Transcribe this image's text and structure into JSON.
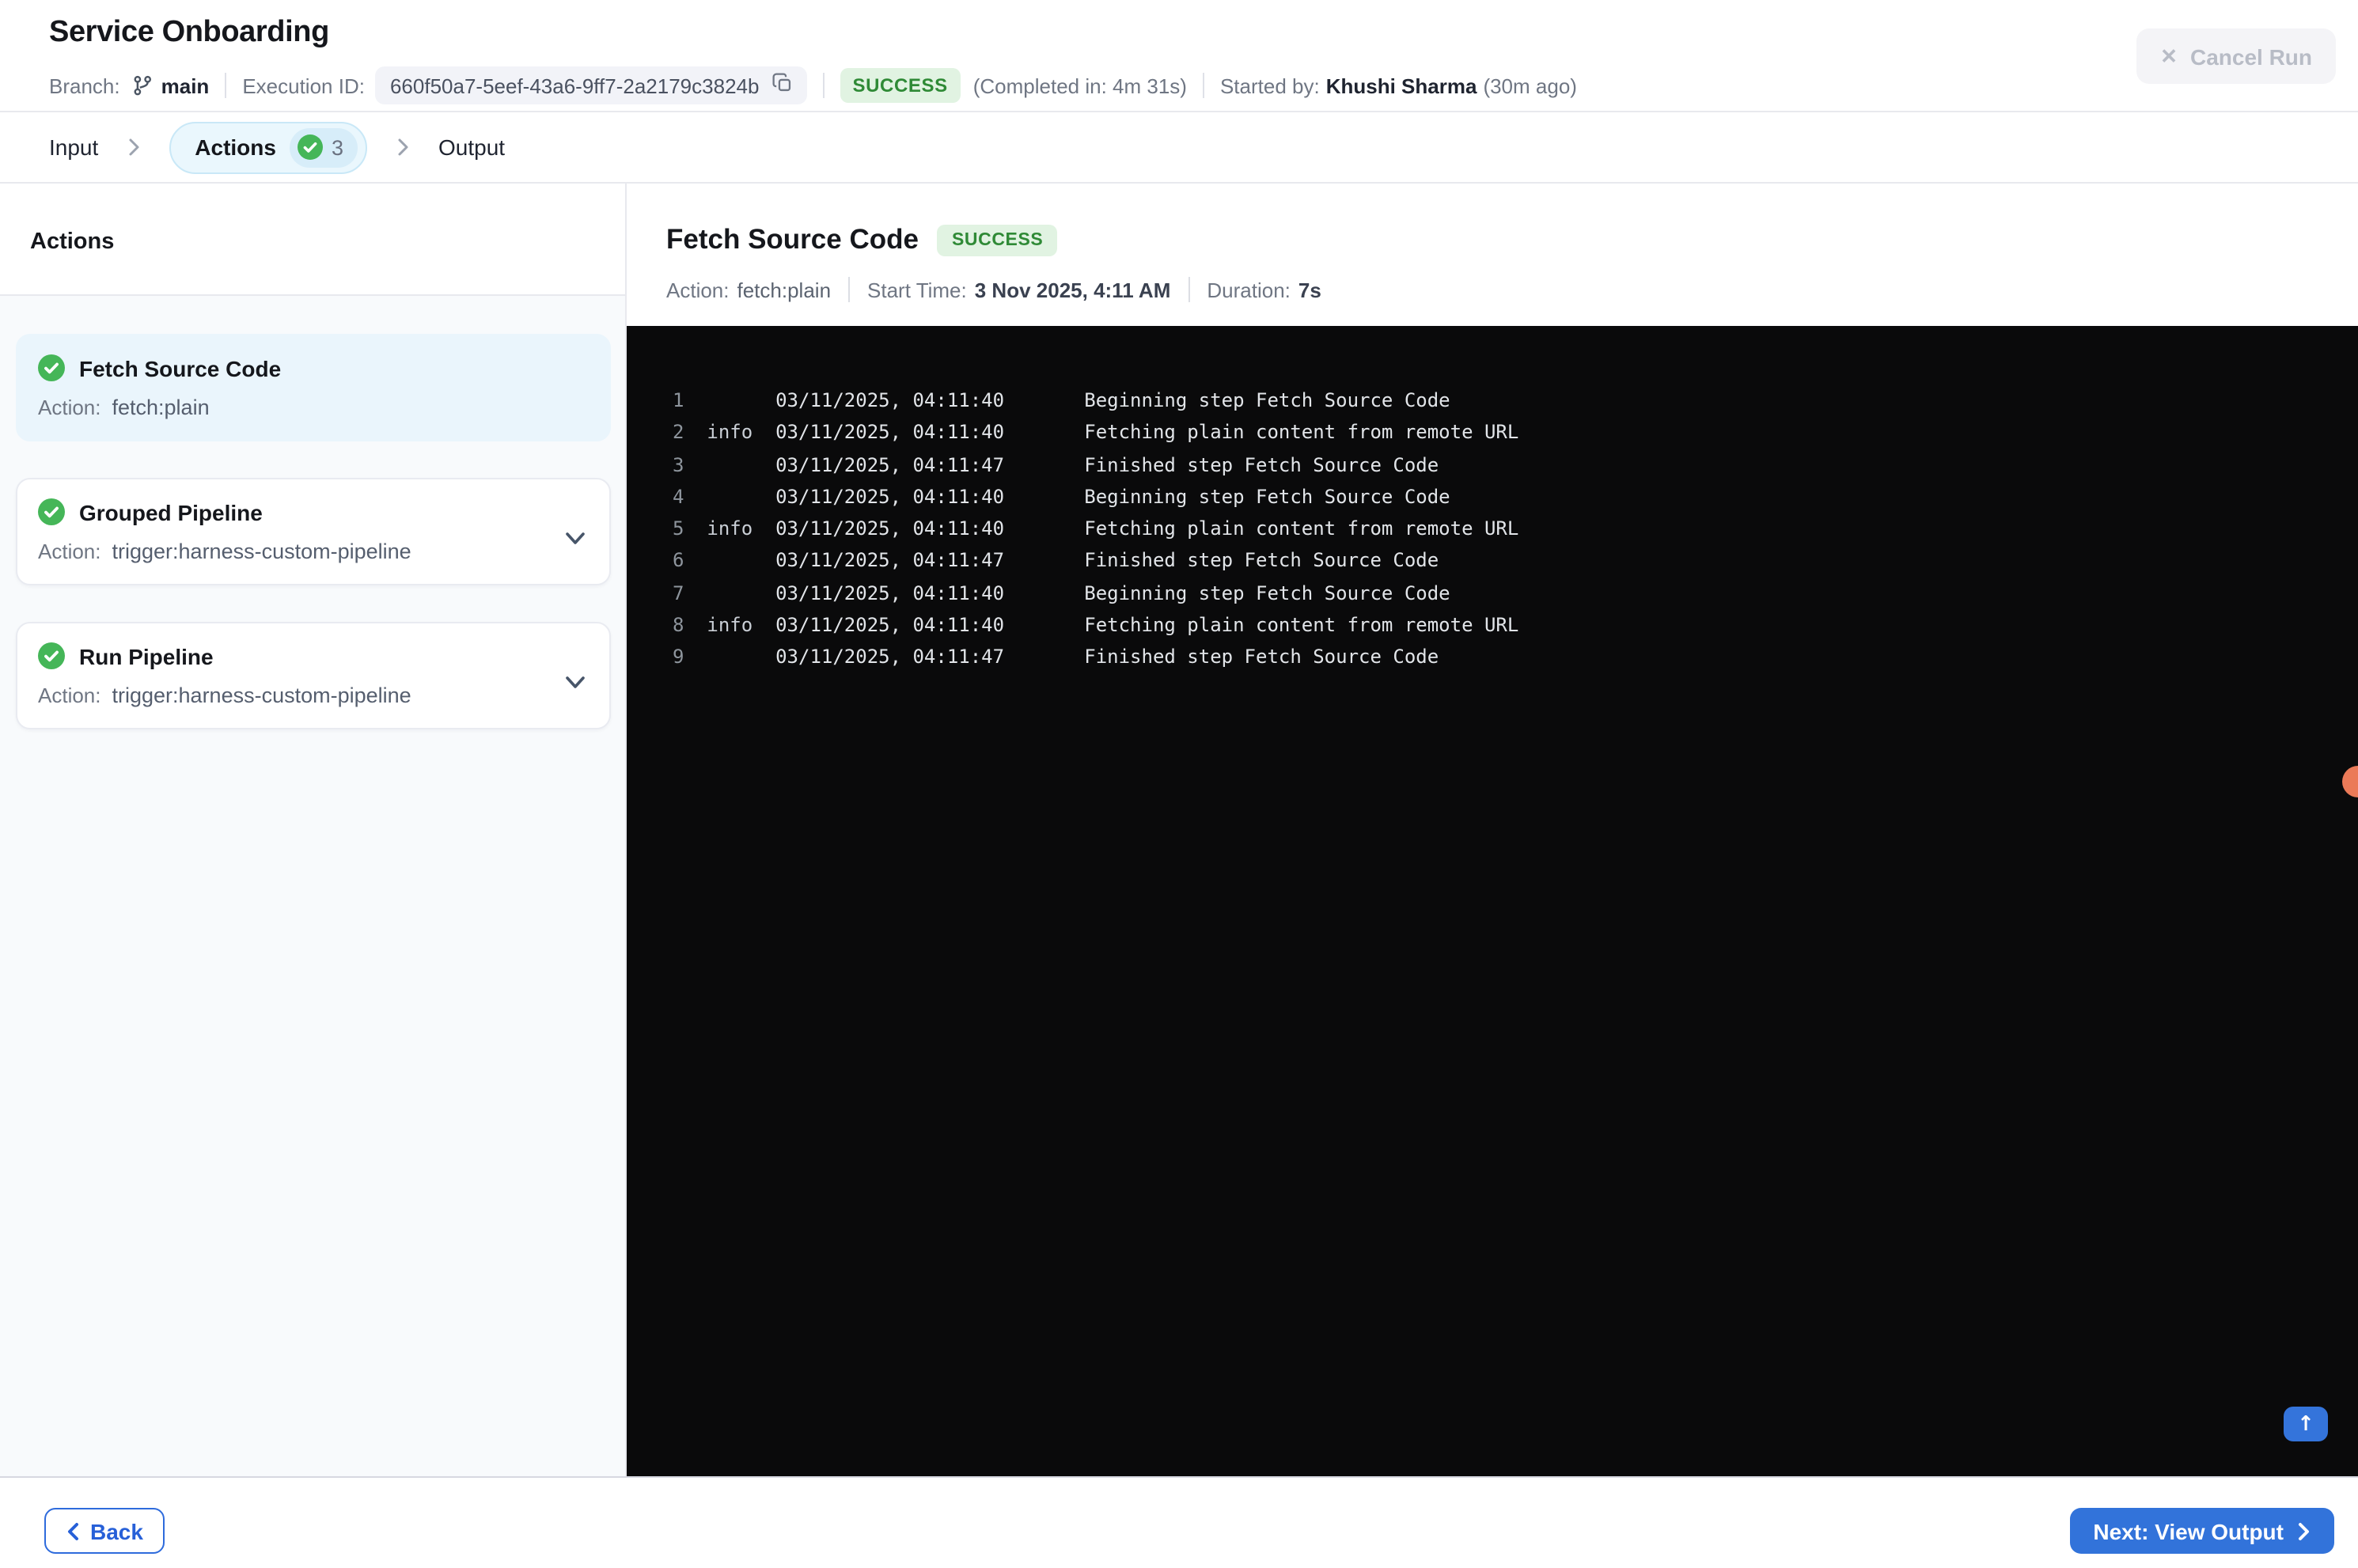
{
  "header": {
    "title": "Service Onboarding",
    "branch_label": "Branch:",
    "branch_name": "main",
    "execution_id_label": "Execution ID:",
    "execution_id": "660f50a7-5eef-43a6-9ff7-2a2179c3824b",
    "status": "SUCCESS",
    "completed_in": "(Completed in: 4m 31s)",
    "started_by_label": "Started by:",
    "started_by": "Khushi Sharma",
    "started_ago": "(30m ago)",
    "cancel_label": "Cancel Run"
  },
  "stepper": {
    "steps": [
      {
        "label": "Input"
      },
      {
        "label": "Actions",
        "count": "3"
      },
      {
        "label": "Output"
      }
    ]
  },
  "sidebar": {
    "heading": "Actions",
    "items": [
      {
        "title": "Fetch Source Code",
        "action_label": "Action:",
        "action": "fetch:plain"
      },
      {
        "title": "Grouped Pipeline",
        "action_label": "Action:",
        "action": "trigger:harness-custom-pipeline"
      },
      {
        "title": "Run Pipeline",
        "action_label": "Action:",
        "action": "trigger:harness-custom-pipeline"
      }
    ]
  },
  "detail": {
    "title": "Fetch Source Code",
    "status": "SUCCESS",
    "action_label": "Action:",
    "action_value": "fetch:plain",
    "start_label": "Start Time:",
    "start_value": "3 Nov 2025, 4:11 AM",
    "duration_label": "Duration:",
    "duration_value": "7s"
  },
  "log": {
    "lines": [
      {
        "n": "1",
        "level": "",
        "time": "03/11/2025, 04:11:40",
        "msg": "Beginning step Fetch Source Code"
      },
      {
        "n": "2",
        "level": "info",
        "time": "03/11/2025, 04:11:40",
        "msg": "Fetching plain content from remote URL"
      },
      {
        "n": "3",
        "level": "",
        "time": "03/11/2025, 04:11:47",
        "msg": "Finished step Fetch Source Code"
      },
      {
        "n": "4",
        "level": "",
        "time": "03/11/2025, 04:11:40",
        "msg": "Beginning step Fetch Source Code"
      },
      {
        "n": "5",
        "level": "info",
        "time": "03/11/2025, 04:11:40",
        "msg": "Fetching plain content from remote URL"
      },
      {
        "n": "6",
        "level": "",
        "time": "03/11/2025, 04:11:47",
        "msg": "Finished step Fetch Source Code"
      },
      {
        "n": "7",
        "level": "",
        "time": "03/11/2025, 04:11:40",
        "msg": "Beginning step Fetch Source Code"
      },
      {
        "n": "8",
        "level": "info",
        "time": "03/11/2025, 04:11:40",
        "msg": "Fetching plain content from remote URL"
      },
      {
        "n": "9",
        "level": "",
        "time": "03/11/2025, 04:11:47",
        "msg": "Finished step Fetch Source Code"
      }
    ]
  },
  "footer": {
    "back_label": "Back",
    "next_label": "Next: View Output"
  },
  "icons": {
    "cancel_x": "✕",
    "scroll_top_arrow": "↑"
  },
  "colors": {
    "accent_blue": "#3273DA",
    "back_button_blue": "#2760D8",
    "success_badge_bg": "#E1F3E2",
    "success_badge_text": "#2F8A36",
    "check_green": "#45B658",
    "console_bg": "#0A0A0B",
    "selected_card_bg": "#EAF5FC",
    "actions_pill_bg": "#EAF7FD",
    "actions_pill_border": "#C9E8F7",
    "count_pill_bg": "#D7EDF9",
    "edge_marker_dot": "#EB7A58"
  }
}
